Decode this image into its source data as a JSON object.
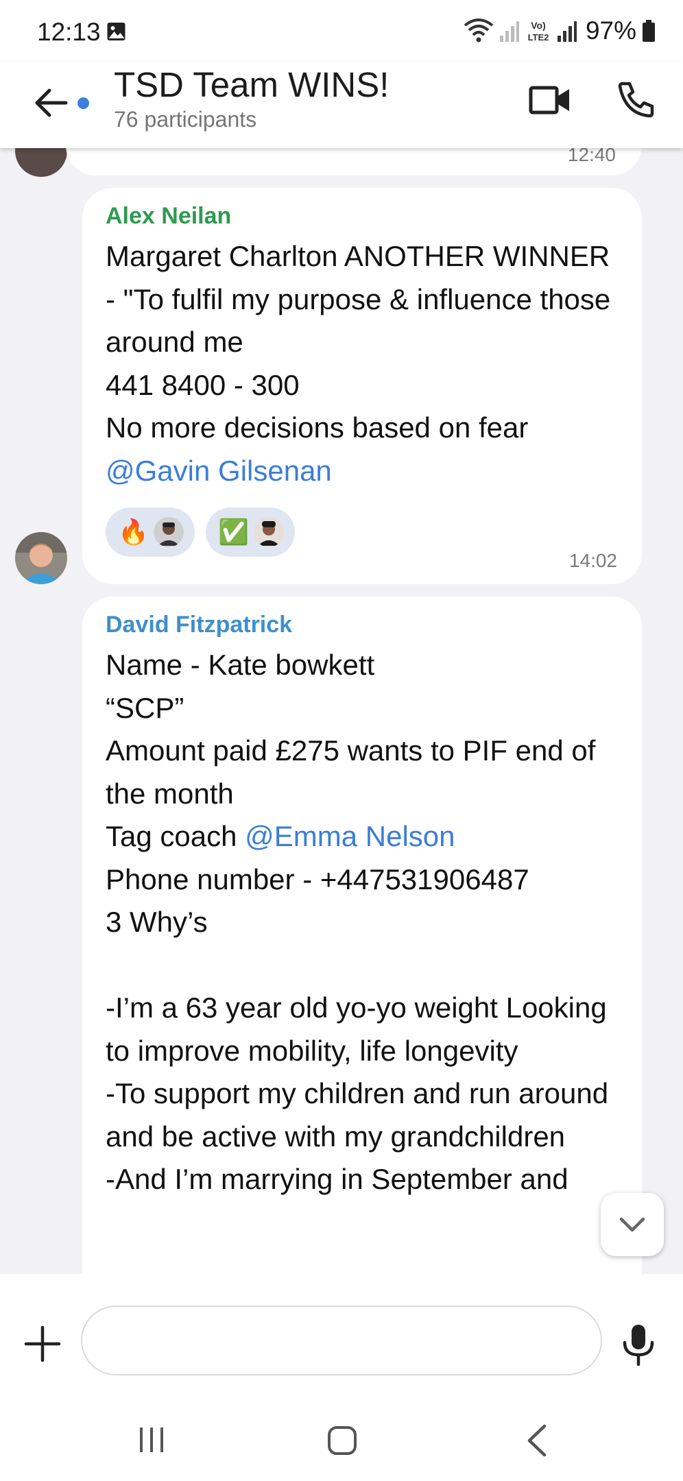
{
  "status_bar": {
    "time": "12:13",
    "battery": "97%",
    "icons": [
      "gallery-icon",
      "wifi-6-icon",
      "signal-icon",
      "volte-lte2-icon",
      "battery-icon"
    ]
  },
  "header": {
    "title": "TSD Team WINS!",
    "subtitle": "76 participants"
  },
  "previous_message": {
    "time": "12:40"
  },
  "messages": [
    {
      "sender": "Alex Neilan",
      "sender_color": "#2e9b4f",
      "text": "Margaret Charlton ANOTHER WINNER - \"To fulfil my purpose & influence those around me\n441 8400 - 300\nNo more decisions based on fear",
      "mention": "@Gavin Gilsenan",
      "reactions": [
        {
          "emoji": "🔥",
          "icon": "fire-emoji"
        },
        {
          "emoji": "✅",
          "icon": "check-mark-emoji"
        }
      ],
      "time": "14:02"
    },
    {
      "sender": "David Fitzpatrick",
      "sender_color": "#3f8fcb",
      "lines_before": "Name - Kate bowkett\n“SCP”\nAmount paid £275 wants to PIF end of the month",
      "tag_prefix": "Tag coach ",
      "mention": "@Emma Nelson",
      "lines_after": "Phone number - +447531906487\n3 Why’s\n\n-I’m a 63 year old yo-yo weight Looking to improve mobility, life longevity\n-To support my children and run around and be active with my grandchildren\n-And I’m marrying in September and"
    }
  ],
  "composer": {
    "placeholder": ""
  }
}
